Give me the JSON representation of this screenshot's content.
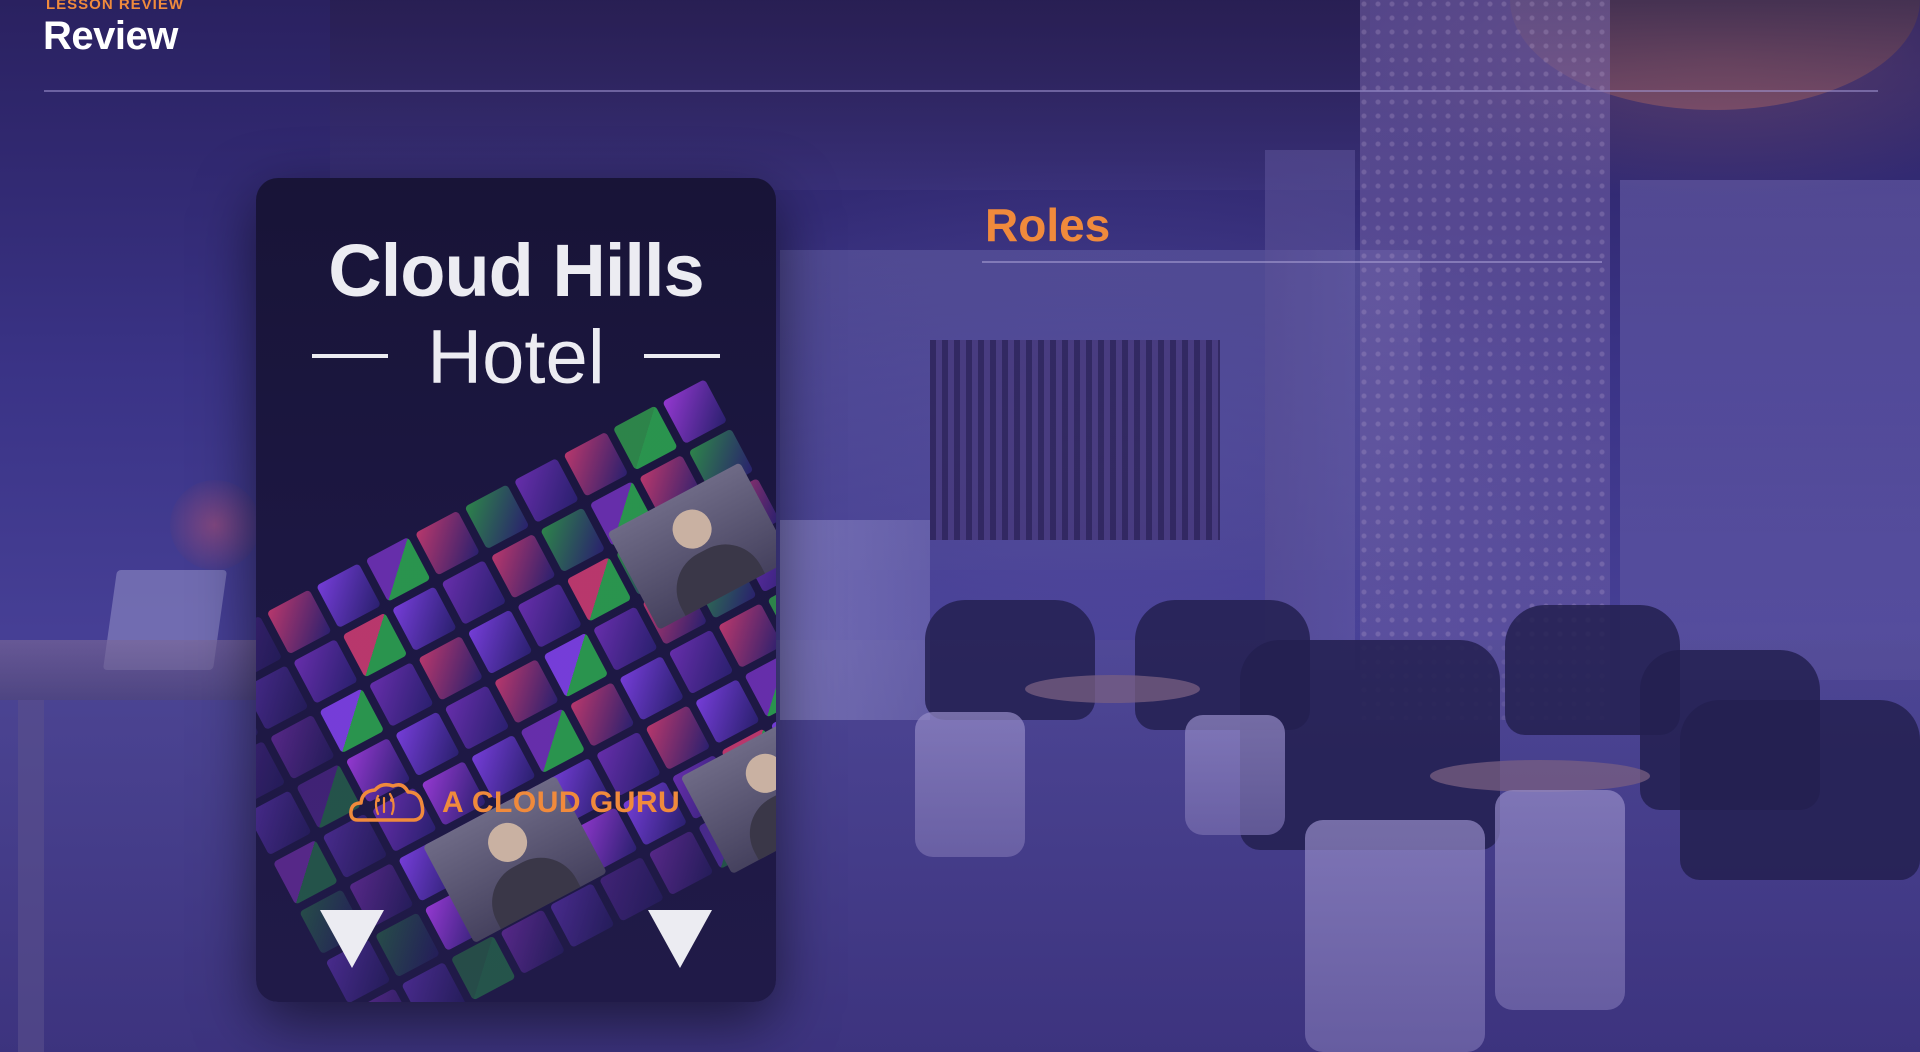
{
  "header": {
    "eyebrow": "LESSON REVIEW",
    "title": "Review"
  },
  "card": {
    "title_line1": "Cloud Hills",
    "title_line2": "Hotel",
    "brand_name": "A CLOUD GURU",
    "brand_icon": "cloud-icon",
    "left_arrow_icon": "triangle-down-icon",
    "right_arrow_icon": "triangle-down-icon"
  },
  "main": {
    "section_heading": "Roles"
  },
  "colors": {
    "accent": "#f08a3c",
    "background": "#3a3386",
    "card_background": "#1c1742",
    "text": "#ffffff"
  }
}
